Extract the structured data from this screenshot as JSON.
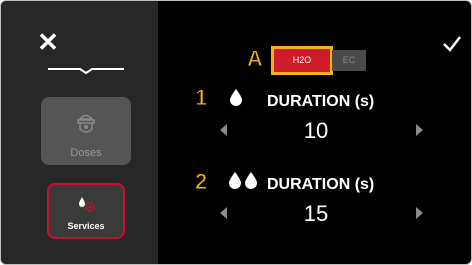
{
  "sidebar": {
    "items": [
      {
        "label": "Doses",
        "state": "disabled"
      },
      {
        "label": "Services",
        "state": "selected"
      }
    ]
  },
  "toggle": {
    "options": [
      "H2O",
      "EC"
    ],
    "selected": "H2O"
  },
  "markers": [
    "A",
    "1",
    "2"
  ],
  "rows": [
    {
      "title": "DURATION (s)",
      "value": "10",
      "icon": "single-drop-icon"
    },
    {
      "title": "DURATION (s)",
      "value": "15",
      "icon": "double-drop-icon"
    }
  ],
  "colors": {
    "accent": "#d11a2a",
    "highlight": "#f2b318",
    "background": "#000000",
    "sidebar": "#272727"
  }
}
